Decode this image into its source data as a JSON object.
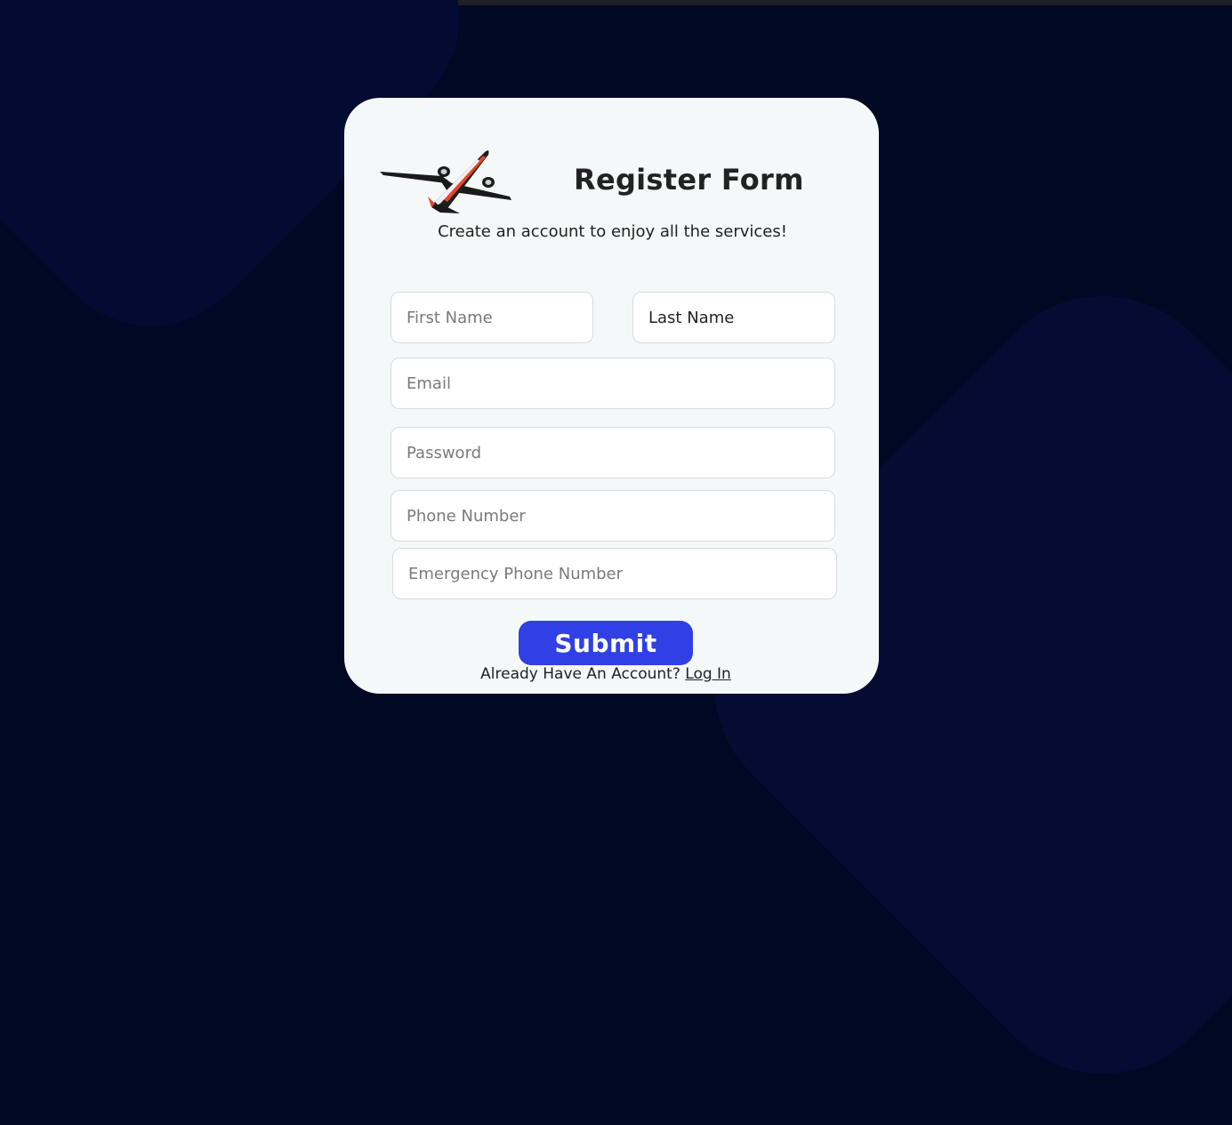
{
  "form": {
    "title": "Register Form",
    "subtitle": "Create an account to enjoy all the services!",
    "logo_icon": "airplane-icon",
    "fields": {
      "first_name": {
        "placeholder": "First Name",
        "value": ""
      },
      "last_name": {
        "placeholder": "Last Name",
        "value": "Last Name"
      },
      "email": {
        "placeholder": "Email",
        "value": ""
      },
      "password": {
        "placeholder": "Password",
        "value": ""
      },
      "phone": {
        "placeholder": "Phone Number",
        "value": ""
      },
      "emergency_phone": {
        "placeholder": "Emergency Phone Number",
        "value": ""
      }
    },
    "submit_label": "Submit",
    "footer_text": "Already Have An Account?",
    "login_link": "Log In"
  },
  "colors": {
    "background": "#000823",
    "card": "#f5f8f8",
    "accent": "#3040e5",
    "plane_stripe": "#e8452e"
  }
}
